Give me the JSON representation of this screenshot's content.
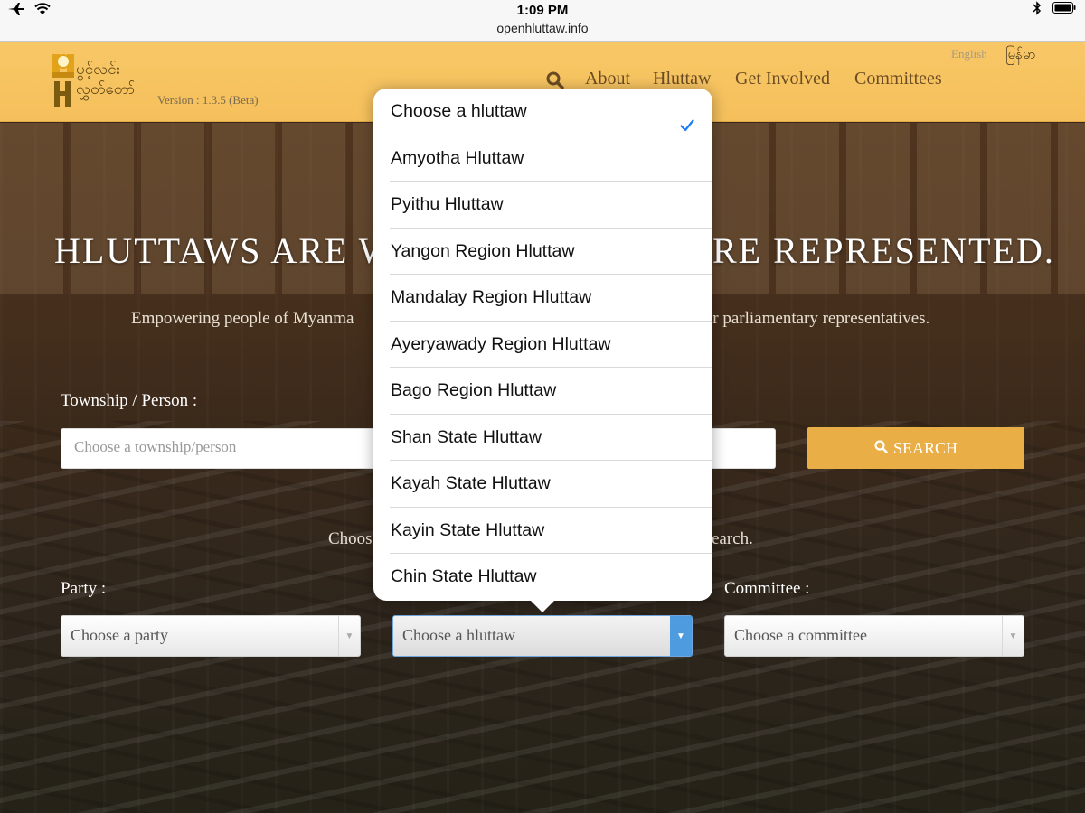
{
  "status_bar": {
    "time": "1:09 PM",
    "url": "openhluttaw.info"
  },
  "header": {
    "logo_text_top": "ပွင့်လင်း",
    "logo_text_bottom": "လွှတ်တော်",
    "version": "Version : 1.3.5 (Beta)",
    "lang_english": "English",
    "lang_myanmar": "မြန်မာ",
    "nav": [
      "About",
      "Hluttaw",
      "Get Involved",
      "Committees"
    ],
    "accent": "#f7c462"
  },
  "hero": {
    "headline_left": "HLUTTAWS ARE W",
    "headline_right": "RE REPRESENTED.",
    "tagline_left": "Empowering people of Myanma",
    "tagline_right": "ir parliamentary representatives.",
    "township_label": "Township / Person :",
    "township_placeholder": "Choose a township/person",
    "search_label": "SEARCH",
    "hint_left": "Choos",
    "hint_right": "earch.",
    "party_label": "Party :",
    "party_select": "Choose a party",
    "hluttaw_select": "Choose a hluttaw",
    "committee_label": "Committee :",
    "committee_select": "Choose a committee",
    "search_button_color": "#e9ae45"
  },
  "picker": {
    "selected_index": 0,
    "options": [
      "Choose a hluttaw",
      "Amyotha Hluttaw",
      "Pyithu Hluttaw",
      "Yangon Region Hluttaw",
      "Mandalay Region Hluttaw",
      "Ayeryawady Region Hluttaw",
      "Bago Region Hluttaw",
      "Shan State Hluttaw",
      "Kayah State Hluttaw",
      "Kayin State Hluttaw",
      "Chin State Hluttaw"
    ],
    "check_color": "#1a7cf4"
  }
}
